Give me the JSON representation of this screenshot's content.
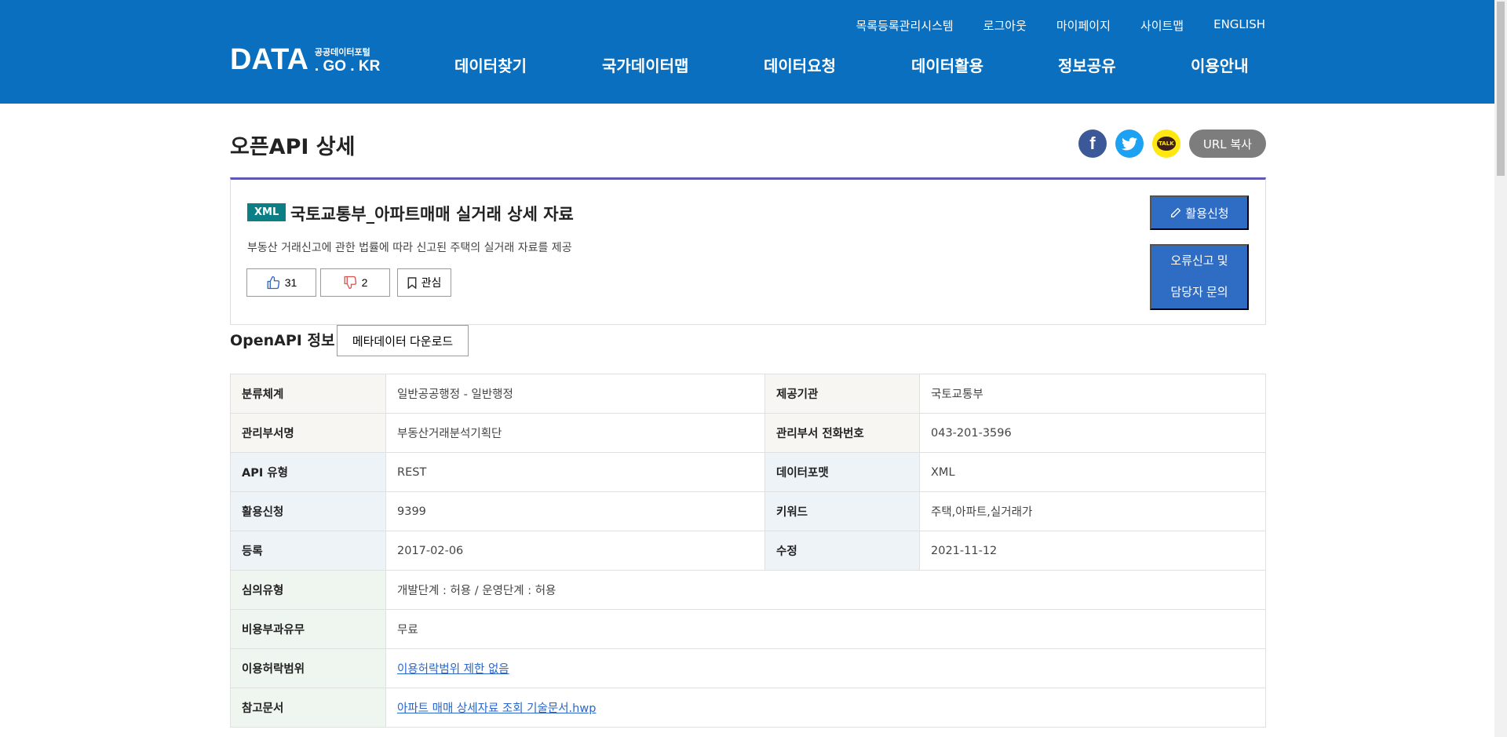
{
  "header": {
    "util_nav": [
      "목록등록관리시스템",
      "로그아웃",
      "마이페이지",
      "사이트맵",
      "ENGLISH"
    ],
    "logo": {
      "main": "DATA",
      "sub": "공공데이터포털",
      "domain": ". GO . KR"
    },
    "gnb": [
      "데이터찾기",
      "국가데이터맵",
      "데이터요청",
      "데이터활용",
      "정보공유",
      "이용안내"
    ]
  },
  "page": {
    "title": "오픈API 상세",
    "share": {
      "facebook_icon": "f",
      "url_copy": "URL 복사",
      "kakao_label": "TALK"
    }
  },
  "summary": {
    "format_badge": "XML",
    "title": "국토교통부_아파트매매 실거래 상세 자료",
    "description": "부동산 거래신고에 관한 법률에 따라 신고된 주택의 실거래 자료를 제공",
    "likes": "31",
    "dislikes": "2",
    "bookmark_label": "관심",
    "apply_label": "활용신청",
    "report_line1": "오류신고 및",
    "report_line2": "담당자 문의"
  },
  "info": {
    "heading": "OpenAPI 정보",
    "metadata_download": "메타데이터 다운로드",
    "rows_pair": [
      {
        "k1": "분류체계",
        "v1": "일반공공행정 - 일반행정",
        "k2": "제공기관",
        "v2": "국토교통부"
      },
      {
        "k1": "관리부서명",
        "v1": "부동산거래분석기획단",
        "k2": "관리부서 전화번호",
        "v2": "043-201-3596"
      },
      {
        "k1": "API 유형",
        "v1": "REST",
        "k2": "데이터포맷",
        "v2": "XML"
      },
      {
        "k1": "활용신청",
        "v1": "9399",
        "k2": "키워드",
        "v2": "주택,아파트,실거래가"
      },
      {
        "k1": "등록",
        "v1": "2017-02-06",
        "k2": "수정",
        "v2": "2021-11-12"
      }
    ],
    "rows_single": [
      {
        "k": "심의유형",
        "v": "개발단계 : 허용 / 운영단계 : 허용"
      },
      {
        "k": "비용부과유무",
        "v": "무료"
      },
      {
        "k": "이용허락범위",
        "v": "이용허락범위 제한 없음"
      },
      {
        "k": "참고문서",
        "v": "아파트 매매 상세자료 조회 기술문서.hwp"
      }
    ]
  },
  "colors": {
    "header_bg": "#0b6fbf",
    "accent_button": "#2f6cc3",
    "badge": "#0b7f85",
    "summary_top_border": "#5d57b5"
  }
}
